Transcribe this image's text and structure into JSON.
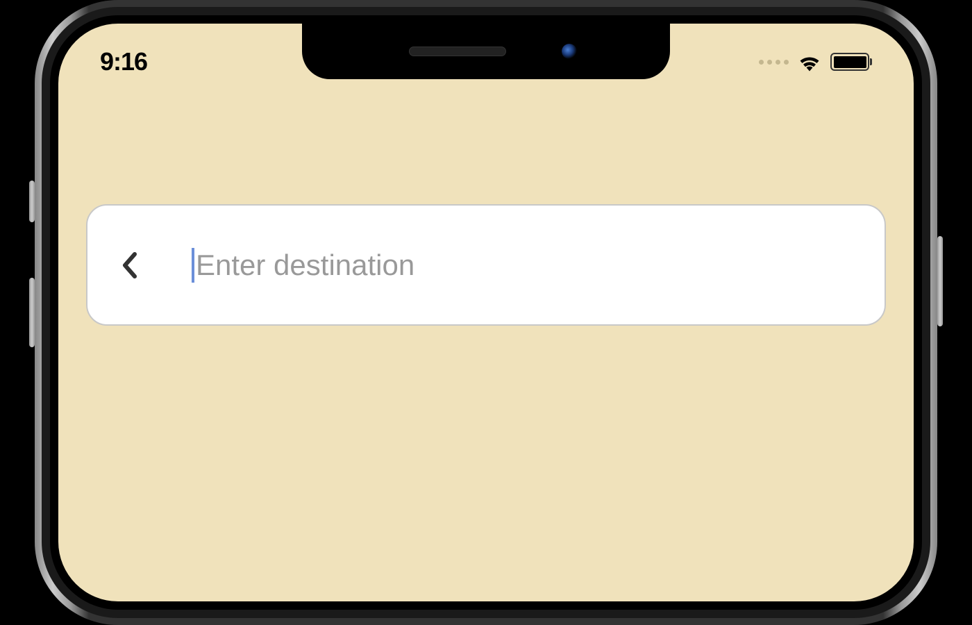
{
  "status_bar": {
    "time": "9:16"
  },
  "search": {
    "placeholder": "Enter destination",
    "value": ""
  }
}
